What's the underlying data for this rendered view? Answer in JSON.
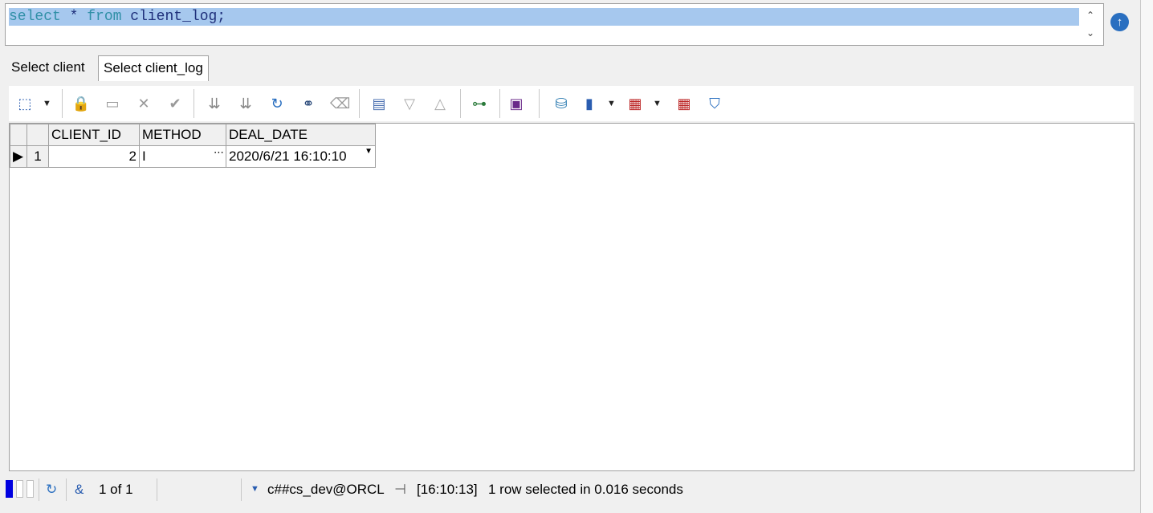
{
  "editor": {
    "sql_kw_select": "select",
    "sql_star": "*",
    "sql_kw_from": "from",
    "sql_table": "client_log;",
    "scroll_up": "⌃",
    "scroll_down": "⌄",
    "run_icon": "arrow-up-circle-icon"
  },
  "tabs": [
    {
      "label": "Select client"
    },
    {
      "label": "Select client_log",
      "active": true
    }
  ],
  "toolbar": {
    "icons": [
      "select-mode-icon",
      "lock-icon",
      "insert-record-icon",
      "delete-record-icon",
      "post-changes-icon",
      "first-record-icon",
      "last-record-icon",
      "refresh-icon",
      "find-icon",
      "clear-icon",
      "query-by-example-icon",
      "next-record-icon",
      "prior-record-icon",
      "tree-view-icon",
      "save-icon",
      "export-icon",
      "chart-icon",
      "grid-format-icon",
      "compare-icon",
      "filter-icon"
    ]
  },
  "grid": {
    "columns": [
      "CLIENT_ID",
      "METHOD",
      "DEAL_DATE"
    ],
    "rows": [
      {
        "num": "1",
        "client_id": "2",
        "method": "I",
        "method_btn": "⋯",
        "deal_date": "2020/6/21 16:10:10",
        "date_btn": "▼"
      }
    ]
  },
  "status": {
    "amp": "&",
    "record": "1 of 1",
    "connection": "c##cs_dev@ORCL",
    "time": "[16:10:13]",
    "message": "1 row selected in 0.016 seconds"
  },
  "colors": {
    "selection": "#a6c8ee",
    "keyword": "#2f8fa6",
    "identifier": "#1e2f7a",
    "run_button": "#2a6fc0"
  }
}
